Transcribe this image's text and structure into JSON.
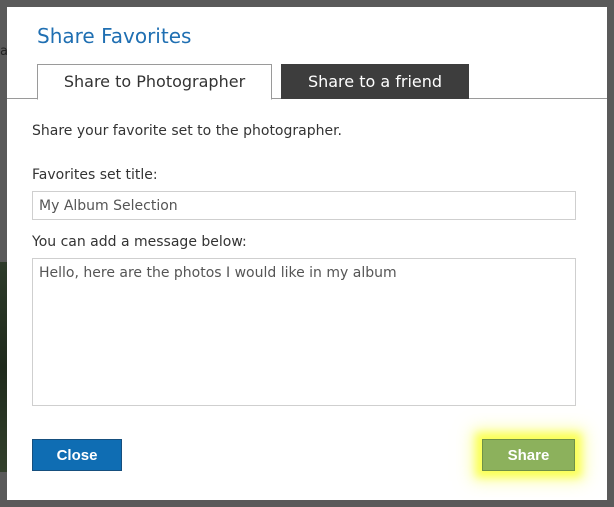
{
  "background": {
    "edge_text": "a"
  },
  "dialog": {
    "title": "Share Favorites",
    "tabs": [
      {
        "label": "Share to Photographer",
        "active": true
      },
      {
        "label": "Share to a friend",
        "active": false
      }
    ],
    "intro_text": "Share your favorite set to the photographer.",
    "title_field": {
      "label": "Favorites set title:",
      "value": "My Album Selection"
    },
    "message_field": {
      "label": "You can add a message below:",
      "value": "Hello, here are the photos I would like in my album"
    },
    "buttons": {
      "close_label": "Close",
      "share_label": "Share"
    }
  },
  "colors": {
    "title": "#1f6fb2",
    "close_button": "#0f6db3",
    "share_button": "#8cb15c",
    "share_highlight": "#faff50",
    "inactive_tab": "#3d3d3d"
  }
}
